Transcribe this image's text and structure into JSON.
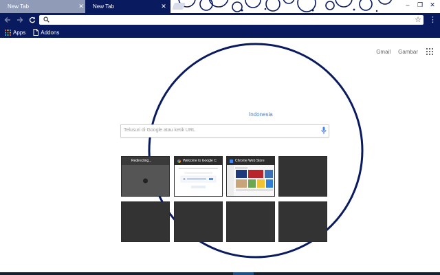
{
  "tabs": [
    {
      "label": "New Tab",
      "active": false
    },
    {
      "label": "New Tab",
      "active": true
    }
  ],
  "window_controls": {
    "minimize": "–",
    "restore": "❐",
    "close": "✕"
  },
  "toolbar": {
    "back_icon": "arrow-left-icon",
    "forward_icon": "arrow-right-icon",
    "reload_icon": "reload-icon",
    "omnibox_value": "",
    "star_icon": "star-icon",
    "menu_icon": "more-vert-icon"
  },
  "bookmarks": [
    {
      "label": "Apps",
      "icon": "apps-grid-icon"
    },
    {
      "label": "Addons",
      "icon": "page-icon"
    }
  ],
  "header_links": {
    "gmail": "Gmail",
    "images": "Gambar"
  },
  "region_label": "Indonesia",
  "search": {
    "placeholder": "Telusuri di Google atau ketik URL"
  },
  "tiles": [
    {
      "title": "Redirecting...",
      "kind": "loading"
    },
    {
      "title": "Welcome to Google C",
      "kind": "google"
    },
    {
      "title": "Chrome Web Store",
      "kind": "webstore"
    },
    {
      "title": "",
      "kind": "empty"
    },
    {
      "title": "",
      "kind": "empty"
    },
    {
      "title": "",
      "kind": "empty"
    },
    {
      "title": "",
      "kind": "empty"
    },
    {
      "title": "",
      "kind": "empty"
    }
  ],
  "colors": {
    "theme_navy": "#0a1a5e",
    "inactive_tab": "#8f9bb7",
    "link_blue": "#4a7cc2",
    "tile_dark": "#333333"
  }
}
